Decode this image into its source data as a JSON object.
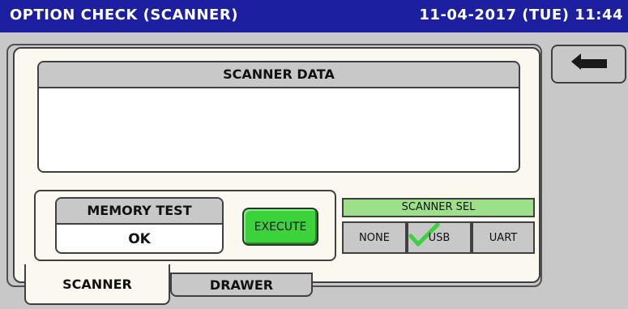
{
  "titlebar": {
    "title": "OPTION CHECK (SCANNER)",
    "clock": "11-04-2017 (TUE) 11:44"
  },
  "scanner_data": {
    "header": "SCANNER DATA",
    "content": ""
  },
  "memory_test": {
    "label": "MEMORY TEST",
    "value": "OK"
  },
  "execute_label": "EXECUTE",
  "scanner_sel": {
    "header": "SCANNER SEL",
    "options": [
      "NONE",
      "USB",
      "UART"
    ],
    "selected": "USB"
  },
  "tabs": [
    "SCANNER",
    "DRAWER"
  ],
  "colors": {
    "titlebar": "#1b1fa0",
    "execute": "#3bd23b",
    "sel_header": "#9ee08a"
  },
  "icons": {
    "back": "back-arrow-icon",
    "check": "check-icon"
  }
}
